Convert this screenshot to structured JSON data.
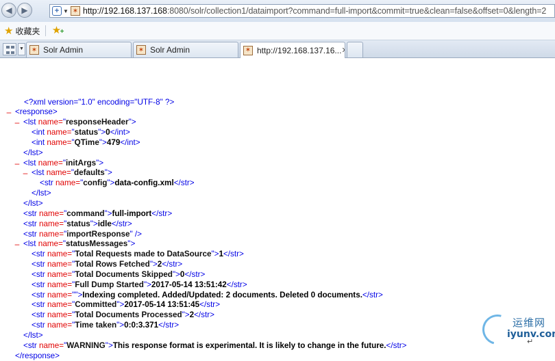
{
  "browser": {
    "url_host": "http://192.168.137.168",
    "url_rest": ":8080/solr/collection1/dataimport?command=full-import&commit=true&clean=false&offset=0&length=2",
    "favorites_label": "收藏夹",
    "tabs": [
      {
        "label": "Solr Admin"
      },
      {
        "label": "Solr Admin"
      },
      {
        "label": "http://192.168.137.16..."
      }
    ]
  },
  "xml": {
    "declaration": "<?xml version=\"1.0\" encoding=\"UTF-8\" ?>",
    "lines": [
      {
        "indent": 0,
        "minus": true,
        "open": "response"
      },
      {
        "indent": 1,
        "minus": true,
        "open": "lst",
        "name": "responseHeader"
      },
      {
        "indent": 2,
        "minus": false,
        "open": "int",
        "name": "status",
        "value": "0",
        "close": "int"
      },
      {
        "indent": 2,
        "minus": false,
        "open": "int",
        "name": "QTime",
        "value": "479",
        "close": "int"
      },
      {
        "indent": 1,
        "minus": false,
        "close": "lst"
      },
      {
        "indent": 1,
        "minus": true,
        "open": "lst",
        "name": "initArgs"
      },
      {
        "indent": 2,
        "minus": true,
        "open": "lst",
        "name": "defaults"
      },
      {
        "indent": 3,
        "minus": false,
        "open": "str",
        "name": "config",
        "value": "data-config.xml",
        "close": "str"
      },
      {
        "indent": 2,
        "minus": false,
        "close": "lst"
      },
      {
        "indent": 1,
        "minus": false,
        "close": "lst"
      },
      {
        "indent": 1,
        "minus": false,
        "open": "str",
        "name": "command",
        "value": "full-import",
        "close": "str"
      },
      {
        "indent": 1,
        "minus": false,
        "open": "str",
        "name": "status",
        "value": "idle",
        "close": "str"
      },
      {
        "indent": 1,
        "minus": false,
        "open": "str",
        "name": "importResponse",
        "selfclose": true
      },
      {
        "indent": 1,
        "minus": true,
        "open": "lst",
        "name": "statusMessages"
      },
      {
        "indent": 2,
        "minus": false,
        "open": "str",
        "name": "Total Requests made to DataSource",
        "value": "1",
        "close": "str"
      },
      {
        "indent": 2,
        "minus": false,
        "open": "str",
        "name": "Total Rows Fetched",
        "value": "2",
        "close": "str"
      },
      {
        "indent": 2,
        "minus": false,
        "open": "str",
        "name": "Total Documents Skipped",
        "value": "0",
        "close": "str"
      },
      {
        "indent": 2,
        "minus": false,
        "open": "str",
        "name": "Full Dump Started",
        "value": "2017-05-14 13:51:42",
        "close": "str"
      },
      {
        "indent": 2,
        "minus": false,
        "open": "str",
        "name": "",
        "value": "Indexing completed. Added/Updated: 2 documents. Deleted 0 documents.",
        "close": "str"
      },
      {
        "indent": 2,
        "minus": false,
        "open": "str",
        "name": "Committed",
        "value": "2017-05-14 13:51:45",
        "close": "str"
      },
      {
        "indent": 2,
        "minus": false,
        "open": "str",
        "name": "Total Documents Processed",
        "value": "2",
        "close": "str"
      },
      {
        "indent": 2,
        "minus": false,
        "open": "str",
        "name": "Time taken",
        "value": "0:0:3.371",
        "close": "str"
      },
      {
        "indent": 1,
        "minus": false,
        "close": "lst"
      },
      {
        "indent": 1,
        "minus": false,
        "open": "str",
        "name": "WARNING",
        "value": "This response format is experimental. It is likely to change in the future.",
        "close": "str"
      },
      {
        "indent": 0,
        "minus": false,
        "close": "response"
      }
    ]
  },
  "watermark": {
    "cn": "运维网",
    "en": "iyunv.com"
  },
  "colors": {
    "tag": "#0000e6",
    "attr": "#e00000",
    "minus": "#e00000"
  },
  "icons": [
    "back-icon",
    "forward-icon",
    "security-shield-icon",
    "site-favicon",
    "favorites-star-icon",
    "add-favorite-icon",
    "quick-tabs-icon",
    "close-tab-icon"
  ]
}
